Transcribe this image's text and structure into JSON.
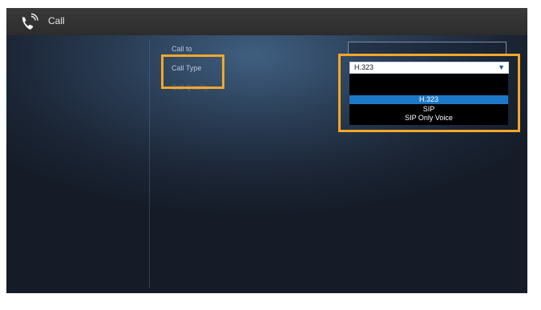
{
  "header": {
    "title": "Call",
    "icon": "phone-icon"
  },
  "form": {
    "call_to_label": "Call to",
    "call_to_value": "",
    "call_type_label": "Call Type",
    "call_quality_label": "Call Quality",
    "call_type_selected": "H.323"
  },
  "dropdown": {
    "arrow": "▼",
    "options": [
      {
        "label": "H.323",
        "selected": true
      },
      {
        "label": "SIP",
        "selected": false
      },
      {
        "label": "SIP Only Voice",
        "selected": false
      }
    ]
  },
  "colors": {
    "highlight": "#f4a72a",
    "selected_option": "#1e78c8"
  }
}
